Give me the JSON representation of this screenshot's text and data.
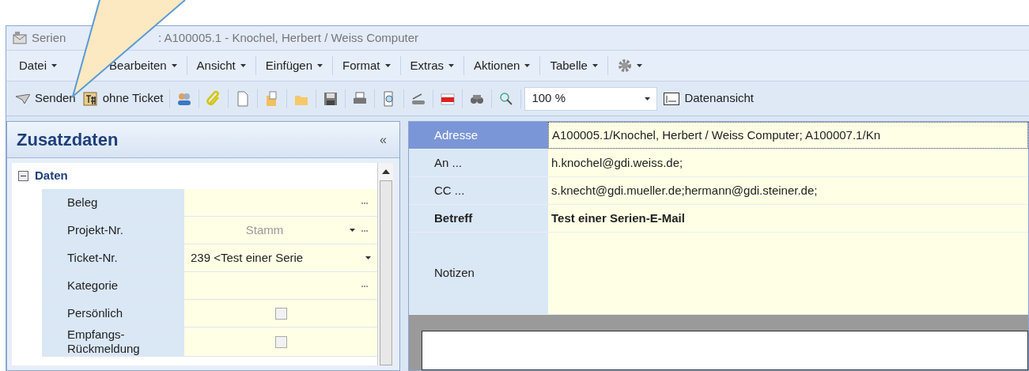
{
  "window": {
    "title_start": "Serien",
    "title_rest": ": A100005.1 - Knochel, Herbert / Weiss Computer"
  },
  "menu": [
    "Datei",
    "Bearbeiten",
    "Ansicht",
    "Einfügen",
    "Format",
    "Extras",
    "Aktionen",
    "Tabelle"
  ],
  "toolbar": {
    "send_button": "Senden",
    "ticket_button": "ohne Ticket",
    "zoom": "100 %",
    "view_button": "Datenansicht"
  },
  "side_panel": {
    "title": "Zusatzdaten",
    "collapse": "«",
    "group": {
      "label": "Daten",
      "expanded": true
    },
    "rows": [
      {
        "label": "Beleg",
        "kind": "field",
        "dropdown": false,
        "ellipsis": true
      },
      {
        "label": "Projekt-Nr.",
        "kind": "field",
        "value": "Stamm",
        "dropdown": true,
        "ellipsis": true,
        "disabled": true
      },
      {
        "label": "Ticket-Nr.",
        "kind": "field",
        "value": "239 <Test einer Serie",
        "dropdown": true,
        "ellipsis": false,
        "disabled": false
      },
      {
        "label": "Kategorie",
        "kind": "field",
        "dropdown": false,
        "ellipsis": true
      },
      {
        "label": "Persönlich",
        "kind": "checkbox",
        "checked": false
      },
      {
        "label": "Empfangs-\nRückmeldung",
        "kind": "checkbox",
        "checked": false
      }
    ]
  },
  "header_fields": [
    {
      "label": "Adresse",
      "value": "A100005.1/Knochel, Herbert / Weiss Computer; A100007.1/Kn",
      "selected": true,
      "bold": false
    },
    {
      "label": "An ...",
      "value": "h.knochel@gdi.weiss.de;",
      "selected": false,
      "bold": false
    },
    {
      "label": "CC ...",
      "value": "s.knecht@gdi.mueller.de;hermann@gdi.steiner.de;",
      "selected": false,
      "bold": false
    },
    {
      "label": "Betreff",
      "value": "Test einer Serien-E-Mail",
      "selected": false,
      "bold": true
    },
    {
      "label": "Notizen",
      "selected": false,
      "bold": false
    }
  ]
}
